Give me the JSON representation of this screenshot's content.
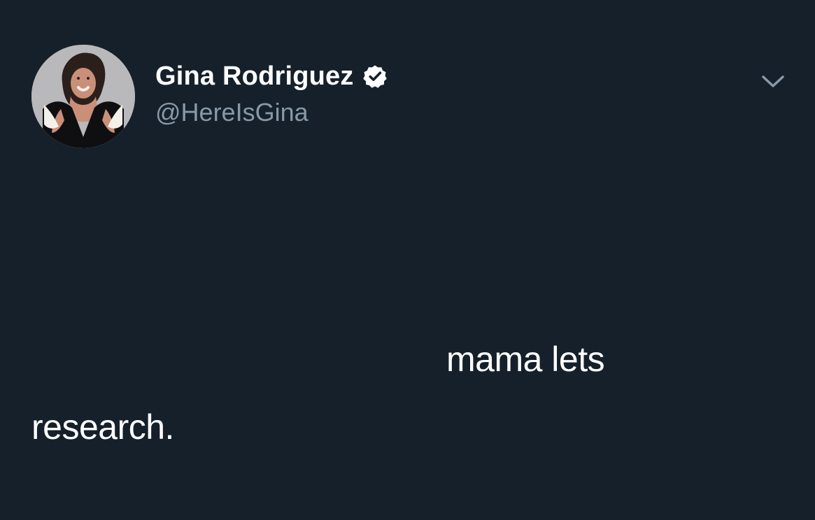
{
  "tweet": {
    "author": {
      "display_name": "Gina Rodriguez",
      "handle": "@HereIsGina",
      "verified": true,
      "avatar_icon": "profile-photo"
    },
    "menu_icon": "chevron-down-icon",
    "text_lines": [
      "mama lets",
      "research."
    ]
  },
  "colors": {
    "background": "#15202b",
    "text": "#ffffff",
    "secondary_text": "#8899a6",
    "verified_badge": "#ffffff"
  }
}
